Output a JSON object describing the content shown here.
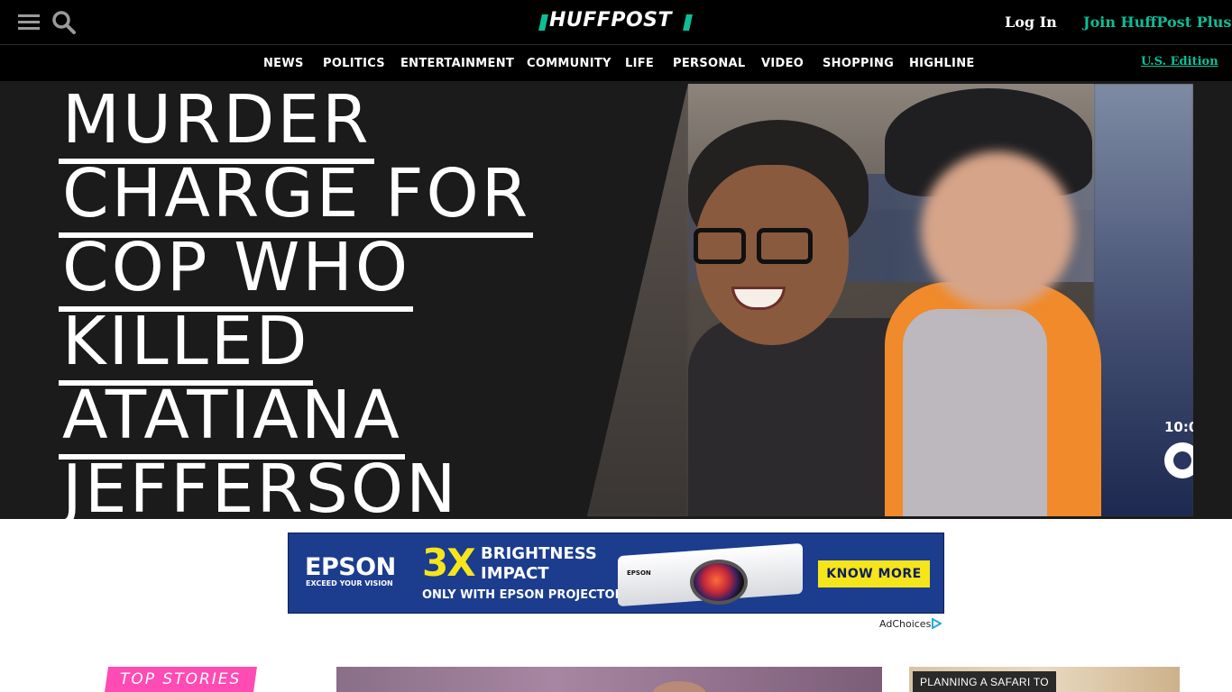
{
  "header": {
    "logo_text": "HUFFPOST",
    "login_label": "Log In",
    "join_label": "Join HuffPost Plus",
    "brand_color": "#0dbe98"
  },
  "nav": {
    "items": [
      "NEWS",
      "POLITICS",
      "ENTERTAINMENT",
      "COMMUNITY",
      "LIFE",
      "PERSONAL",
      "VIDEO",
      "SHOPPING",
      "HIGHLINE"
    ],
    "edition_label": "U.S. Edition"
  },
  "hero": {
    "headline_lines": [
      "MURDER",
      "CHARGE FOR",
      "COP WHO",
      "KILLED",
      "ATATIANA",
      "JEFFERSON"
    ],
    "photo_watermark": "10:0"
  },
  "ad": {
    "brand": "EPSON",
    "tagline": "EXCEED YOUR VISION",
    "big_text": "3X",
    "line1": "BRIGHTNESS",
    "line1b": "IMPACT",
    "line2": "ONLY WITH EPSON PROJECTORS",
    "product_label": "EPSON",
    "cta": "KNOW MORE",
    "adchoices": "AdChoices"
  },
  "sections": {
    "top_stories_label": "TOP STORIES",
    "thumb_tag": "PLANNING A SAFARI TO"
  },
  "icons": {
    "menu": "hamburger-menu-icon",
    "search": "search-icon",
    "adchoices": "adchoices-icon"
  }
}
